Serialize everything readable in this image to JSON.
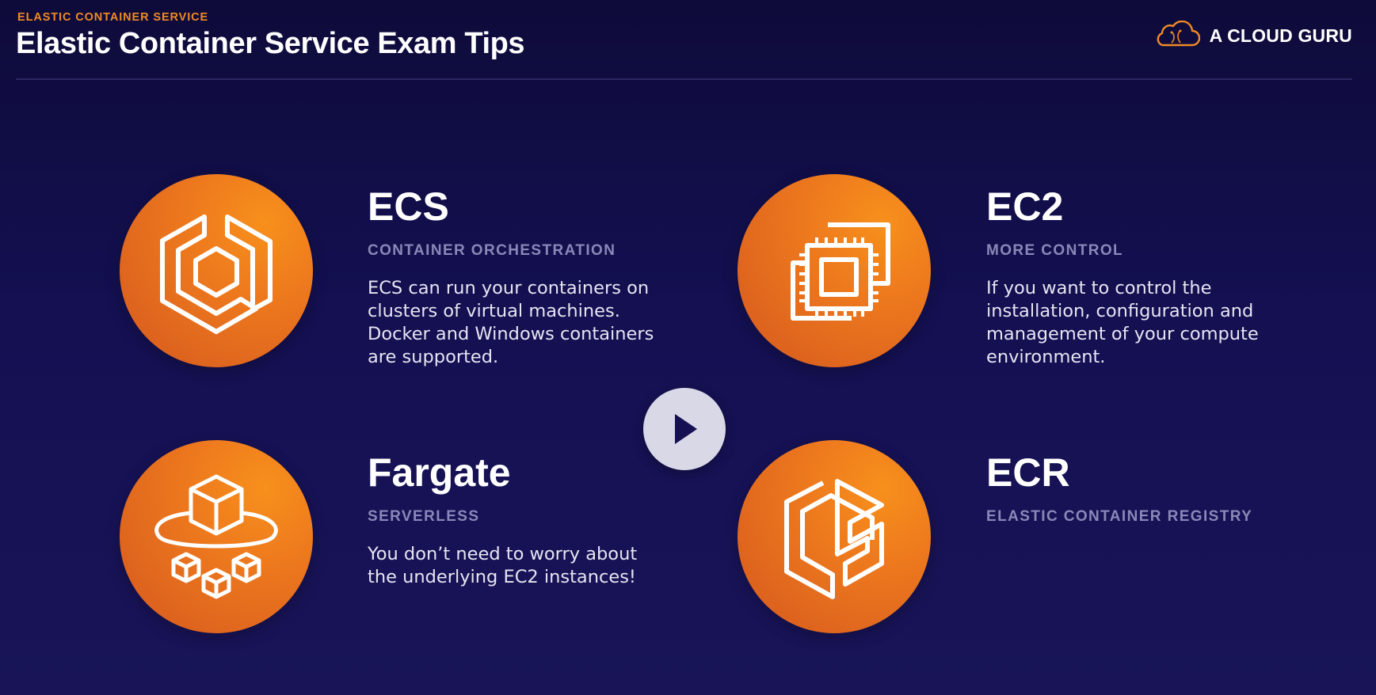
{
  "header": {
    "eyebrow": "ELASTIC CONTAINER SERVICE",
    "title": "Elastic Container Service Exam Tips"
  },
  "brand": {
    "name": "A CLOUD GURU",
    "icon": "cloud-logo-icon",
    "color": "#f08a24"
  },
  "accent_color": "#ee7a1d",
  "cards": [
    {
      "icon": "ecs-icon",
      "heading": "ECS",
      "subtitle": "CONTAINER ORCHESTRATION",
      "body": "ECS can run your containers on clusters of virtual machines. Docker and Windows containers are supported."
    },
    {
      "icon": "ec2-chip-icon",
      "heading": "EC2",
      "subtitle": "MORE CONTROL",
      "body": "If you want to control the installation, configuration and management of your compute environment."
    },
    {
      "icon": "fargate-icon",
      "heading": "Fargate",
      "subtitle": "SERVERLESS",
      "body": "You don’t need to worry about the underlying EC2 instances!"
    },
    {
      "icon": "ecr-icon",
      "heading": "ECR",
      "subtitle": "ELASTIC CONTAINER REGISTRY",
      "body": ""
    }
  ],
  "player": {
    "icon": "play-icon"
  }
}
